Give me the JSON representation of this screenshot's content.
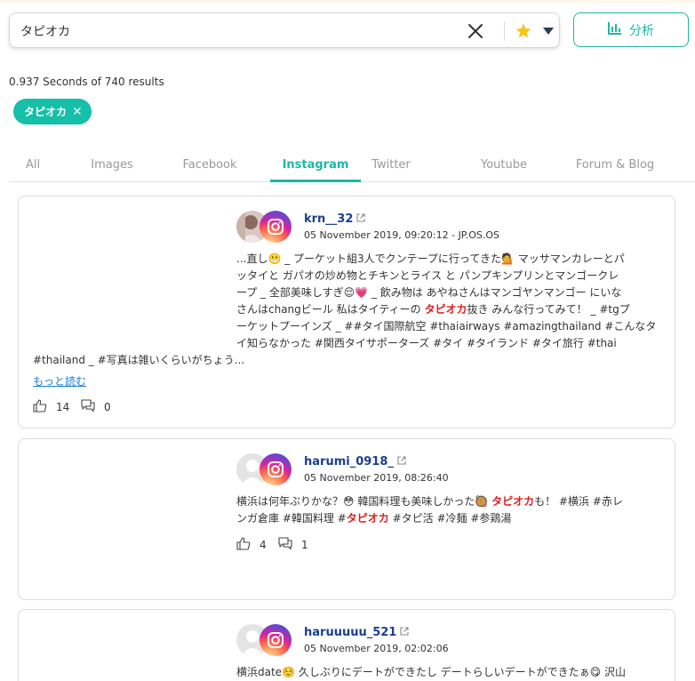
{
  "search": {
    "query": "タピオカ"
  },
  "analyze_button": {
    "label": "分析"
  },
  "result_stats": "0.937 Seconds of 740 results",
  "tag_chip": {
    "label": "タピオカ"
  },
  "tabs": [
    {
      "label": "All"
    },
    {
      "label": "Images"
    },
    {
      "label": "Facebook"
    },
    {
      "label": "Instagram"
    },
    {
      "label": "Twitter"
    },
    {
      "label": "Youtube"
    },
    {
      "label": "Forum & Blog"
    }
  ],
  "active_tab": "Instagram",
  "colors": {
    "accent": "#1fb5a5",
    "chip": "#15bfa8",
    "highlight": "#e02020",
    "username": "#1a3f8f",
    "link": "#1a7fd4"
  },
  "posts": [
    {
      "username": "krn__32",
      "time": "05 November 2019, 09:20:12 - JP.OS.OS",
      "text_lines": [
        [
          "...直し😬 _ プーケット組3人でクンテープに行ってきた💁 マッサマンカレーとパ"
        ],
        [
          "ッタイと ガパオの炒め物とチキンとライス と パンプキンプリンとマンゴークレ"
        ],
        [
          "ープ _ 全部美味しすぎ😌💗 _ 飲み物は あやねさんはマンゴヤンマンゴー にいな"
        ],
        [
          "さんはchangビール 私はタイティーの ",
          "タピオカ",
          "抜き みんな行ってみて！ _ #tgプ"
        ],
        [
          "ーケットプーインズ _ ##タイ国際航空 #thaiairways #amazingthailand #こんなタ"
        ],
        [
          "イ知らなかった #関西タイサポーターズ #タイ #タイランド #タイ旅行 #thai"
        ],
        [
          "#thailand _ #写真は雑いくらいがちょう..."
        ]
      ],
      "read_more": "もっと読む",
      "likes": "14",
      "comments": "0"
    },
    {
      "username": "harumi_0918_",
      "time": "05 November 2019, 08:26:40",
      "text_lines": [
        [
          "横浜は何年ぶりかな？😳 韓国料理も美味しかった🥘 ",
          "タピオカ",
          "も！ #横浜 #赤レ"
        ],
        [
          "ンガ倉庫 #韓国料理 #",
          "タピオカ",
          " #タピ活 #冷麺 #参鶏湯"
        ]
      ],
      "likes": "4",
      "comments": "1"
    },
    {
      "username": "haruuuuu_521",
      "time": "05 November 2019, 02:02:06",
      "text_lines": [
        [
          "横浜date☺️ 久しぶりにデートができたし デートらしいデートができたぁ😋 沢山"
        ]
      ]
    }
  ]
}
